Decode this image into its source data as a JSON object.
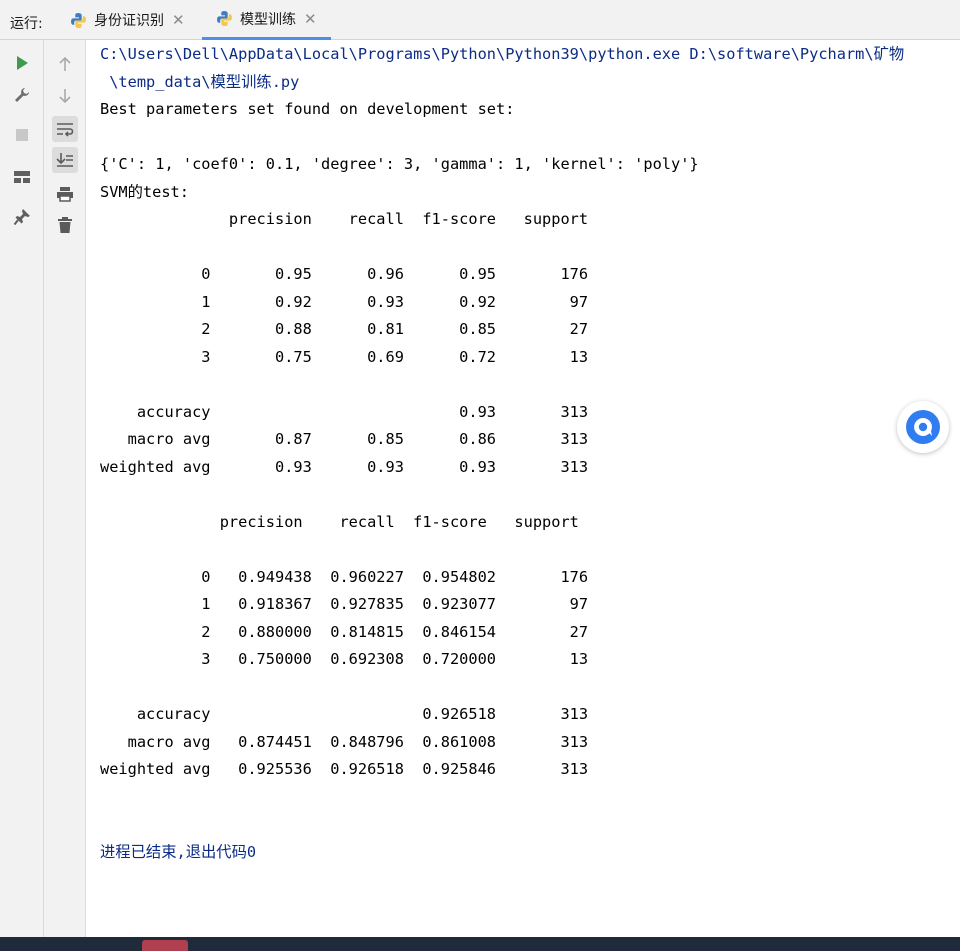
{
  "run_label": "运行:",
  "tabs": [
    {
      "label": "身份证识别",
      "active": false
    },
    {
      "label": "模型训练",
      "active": true
    }
  ],
  "colors": {
    "accent": "#4d8fe8",
    "command_text": "#0b2b86",
    "run_green": "#3d9a4e"
  },
  "toolbar_left": [
    "run-icon",
    "wrench-icon",
    "stop-icon",
    "layout-icon",
    "pin-icon"
  ],
  "toolbar_right": [
    "arrow-up-icon",
    "arrow-down-icon",
    "soft-wrap-icon",
    "scroll-to-end-icon",
    "print-icon",
    "trash-icon"
  ],
  "console": {
    "lines": [
      "C:\\Users\\Dell\\AppData\\Local\\Programs\\Python\\Python39\\python.exe D:\\software\\Pycharm\\矿物",
      " \\temp_data\\模型训练.py",
      "Best parameters set found on development set:",
      "",
      "{'C': 1, 'coef0': 0.1, 'degree': 3, 'gamma': 1, 'kernel': 'poly'}",
      "SVM的test:",
      "              precision    recall  f1-score   support",
      "",
      "           0       0.95      0.96      0.95       176",
      "           1       0.92      0.93      0.92        97",
      "           2       0.88      0.81      0.85        27",
      "           3       0.75      0.69      0.72        13",
      "",
      "    accuracy                           0.93       313",
      "   macro avg       0.87      0.85      0.86       313",
      "weighted avg       0.93      0.93      0.93       313",
      "",
      "             precision    recall  f1-score   support",
      "",
      "           0   0.949438  0.960227  0.954802       176",
      "           1   0.918367  0.927835  0.923077        97",
      "           2   0.880000  0.814815  0.846154        27",
      "           3   0.750000  0.692308  0.720000        13",
      "",
      "    accuracy                       0.926518       313",
      "   macro avg   0.874451  0.848796  0.861008       313",
      "weighted avg   0.925536  0.926518  0.925846       313",
      "",
      "",
      "进程已结束,退出代码0"
    ]
  }
}
